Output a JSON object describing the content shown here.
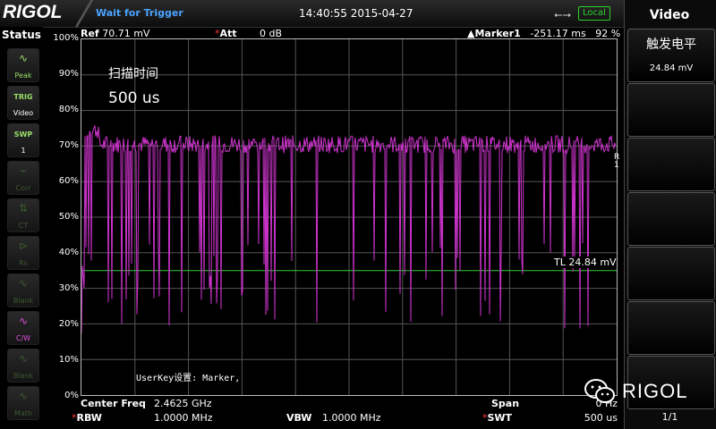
{
  "header": {
    "brand": "RIGOL",
    "trigger_status": "Wait for Trigger",
    "datetime": "14:40:55 2015-04-27",
    "usb_icon": "usb-icon",
    "local_badge": "Local"
  },
  "status": {
    "title": "Status",
    "buttons": [
      {
        "label": "Peak",
        "icon": "peak-wave-icon"
      },
      {
        "label1": "TRIG",
        "label2": "Video"
      },
      {
        "label1": "SWP",
        "label2": "1"
      },
      {
        "label": "Corr",
        "icon": "corr-icon"
      },
      {
        "label": "CT",
        "icon": "ct-icon"
      },
      {
        "label": "Rs",
        "icon": "rs-icon"
      },
      {
        "label": "Blank",
        "icon": "blank-wave-icon"
      },
      {
        "label": "C/W",
        "icon": "clear-write-icon"
      },
      {
        "label": "Blank",
        "icon": "blank-wave-icon"
      },
      {
        "label": "Math",
        "icon": "math-icon"
      }
    ]
  },
  "trace_header": {
    "ref_label": "Ref",
    "ref_value": "70.71 mV",
    "att_label": "Att",
    "att_value": "0 dB",
    "marker_label": "Marker1",
    "marker_time": "-251.17 ms",
    "marker_pct": "92 %"
  },
  "plot": {
    "y_ticks": [
      "100%",
      "90%",
      "80%",
      "70%",
      "60%",
      "50%",
      "40%",
      "30%",
      "20%",
      "10%",
      "0%"
    ],
    "overlay_title": "扫描时间",
    "overlay_value": "500 us",
    "user_key": "UserKey设置:   Marker,",
    "tl_label": "TL 24.84 mV",
    "right_marker": "R 1",
    "trace_color": "#cc33cc",
    "threshold_color": "#33cc33",
    "threshold_level": 0.35
  },
  "footer": {
    "center_freq_label": "Center Freq",
    "center_freq_value": "2.4625 GHz",
    "rbw_label": "RBW",
    "rbw_value": "1.0000 MHz",
    "vbw_label": "VBW",
    "vbw_value": "1.0000 MHz",
    "span_label": "Span",
    "span_value": "0 Hz",
    "swt_label": "SWT",
    "swt_value": "500 us"
  },
  "softkeys": {
    "menu_title": "Video",
    "key1_label": "触发电平",
    "key1_value": "24.84 mV",
    "page": "1/1",
    "watermark": "RIGOL"
  }
}
